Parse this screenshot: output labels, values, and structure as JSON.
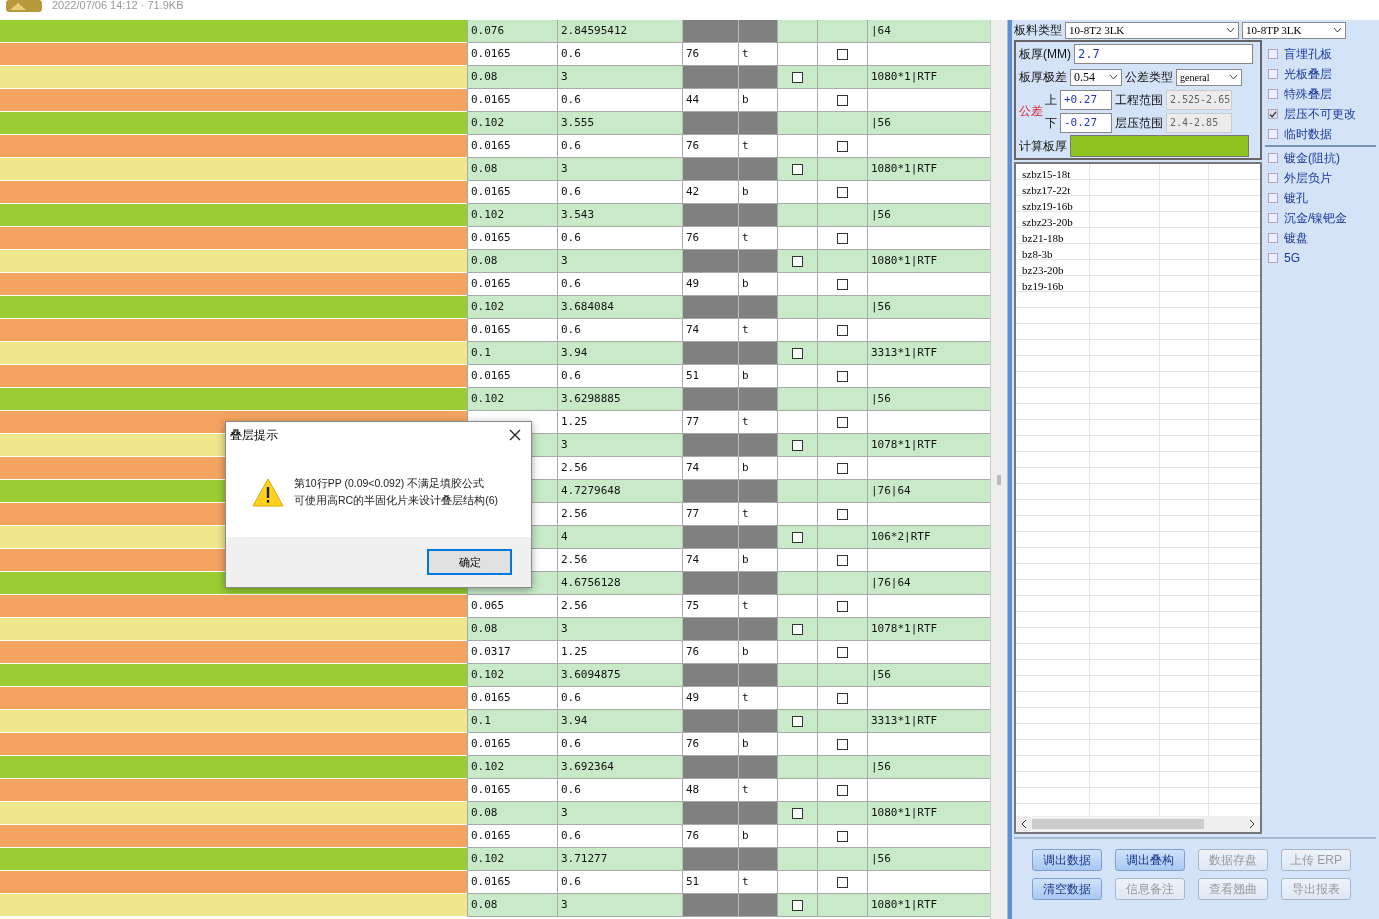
{
  "file_info": "2022/07/06 14:12 · 71.9KB",
  "rows": [
    {
      "kind": "core",
      "color": "#9acd32",
      "column_1": "0.076",
      "column_2": "2.84595412",
      "column_7": "|64"
    },
    {
      "kind": "copper",
      "color": "#f4a460",
      "column_1": "0.0165",
      "column_2": "0.6",
      "column_3": "76",
      "column_4": "t",
      "checked": false
    },
    {
      "kind": "pp",
      "color": "#f0e68c",
      "column_1": "0.08",
      "column_2": "3",
      "column_7": "1080*1|RTF",
      "checked": false
    },
    {
      "kind": "copper",
      "color": "#f4a460",
      "column_1": "0.0165",
      "column_2": "0.6",
      "column_3": "44",
      "column_4": "b",
      "checked": false
    },
    {
      "kind": "core",
      "color": "#9acd32",
      "column_1": "0.102",
      "column_2": "3.555",
      "column_7": "|56"
    },
    {
      "kind": "copper",
      "color": "#f4a460",
      "column_1": "0.0165",
      "column_2": "0.6",
      "column_3": "76",
      "column_4": "t",
      "checked": false
    },
    {
      "kind": "pp",
      "color": "#f0e68c",
      "column_1": "0.08",
      "column_2": "3",
      "column_7": "1080*1|RTF",
      "checked": false
    },
    {
      "kind": "copper",
      "color": "#f4a460",
      "column_1": "0.0165",
      "column_2": "0.6",
      "column_3": "42",
      "column_4": "b",
      "checked": false
    },
    {
      "kind": "core",
      "color": "#9acd32",
      "column_1": "0.102",
      "column_2": "3.543",
      "column_7": "|56"
    },
    {
      "kind": "copper",
      "color": "#f4a460",
      "column_1": "0.0165",
      "column_2": "0.6",
      "column_3": "76",
      "column_4": "t",
      "checked": false
    },
    {
      "kind": "pp",
      "color": "#f0e68c",
      "column_1": "0.08",
      "column_2": "3",
      "column_7": "1080*1|RTF",
      "checked": false
    },
    {
      "kind": "copper",
      "color": "#f4a460",
      "column_1": "0.0165",
      "column_2": "0.6",
      "column_3": "49",
      "column_4": "b",
      "checked": false
    },
    {
      "kind": "core",
      "color": "#9acd32",
      "column_1": "0.102",
      "column_2": "3.684084",
      "column_7": "|56"
    },
    {
      "kind": "copper",
      "color": "#f4a460",
      "column_1": "0.0165",
      "column_2": "0.6",
      "column_3": "74",
      "column_4": "t",
      "checked": false
    },
    {
      "kind": "pp",
      "color": "#f0e68c",
      "column_1": "0.1",
      "column_2": "3.94",
      "column_7": "3313*1|RTF",
      "checked": false
    },
    {
      "kind": "copper",
      "color": "#f4a460",
      "column_1": "0.0165",
      "column_2": "0.6",
      "column_3": "51",
      "column_4": "b",
      "checked": false
    },
    {
      "kind": "core",
      "color": "#9acd32",
      "column_1": "0.102",
      "column_2": "3.6298885",
      "column_7": "|56"
    },
    {
      "kind": "copper",
      "color": "#f4a460",
      "column_2": "1.25",
      "column_3": "77",
      "column_4": "t",
      "checked": false
    },
    {
      "kind": "pp",
      "color": "#f0e68c",
      "column_2": "3",
      "column_7": "1078*1|RTF",
      "checked": false
    },
    {
      "kind": "copper",
      "color": "#f4a460",
      "column_2": "2.56",
      "column_3": "74",
      "column_4": "b",
      "checked": false
    },
    {
      "kind": "core",
      "color": "#9acd32",
      "column_2": "4.7279648",
      "column_7": "|76|64"
    },
    {
      "kind": "copper",
      "color": "#f4a460",
      "column_2": "2.56",
      "column_3": "77",
      "column_4": "t",
      "checked": false
    },
    {
      "kind": "pp",
      "color": "#f0e68c",
      "column_2": "4",
      "column_7": "106*2|RTF",
      "checked": false
    },
    {
      "kind": "copper",
      "color": "#f4a460",
      "column_2": "2.56",
      "column_3": "74",
      "column_4": "b",
      "checked": false
    },
    {
      "kind": "core",
      "color": "#9acd32",
      "column_2": "4.6756128",
      "column_7": "|76|64"
    },
    {
      "kind": "copper",
      "color": "#f4a460",
      "column_1": "0.065",
      "column_2": "2.56",
      "column_3": "75",
      "column_4": "t",
      "checked": false
    },
    {
      "kind": "pp",
      "color": "#f0e68c",
      "column_1": "0.08",
      "column_2": "3",
      "column_7": "1078*1|RTF",
      "checked": false
    },
    {
      "kind": "copper",
      "color": "#f4a460",
      "column_1": "0.0317",
      "column_2": "1.25",
      "column_3": "76",
      "column_4": "b",
      "checked": false
    },
    {
      "kind": "core",
      "color": "#9acd32",
      "column_1": "0.102",
      "column_2": "3.6094875",
      "column_7": "|56"
    },
    {
      "kind": "copper",
      "color": "#f4a460",
      "column_1": "0.0165",
      "column_2": "0.6",
      "column_3": "49",
      "column_4": "t",
      "checked": false
    },
    {
      "kind": "pp",
      "color": "#f0e68c",
      "column_1": "0.1",
      "column_2": "3.94",
      "column_7": "3313*1|RTF",
      "checked": false
    },
    {
      "kind": "copper",
      "color": "#f4a460",
      "column_1": "0.0165",
      "column_2": "0.6",
      "column_3": "76",
      "column_4": "b",
      "checked": false
    },
    {
      "kind": "core",
      "color": "#9acd32",
      "column_1": "0.102",
      "column_2": "3.692364",
      "column_7": "|56"
    },
    {
      "kind": "copper",
      "color": "#f4a460",
      "column_1": "0.0165",
      "column_2": "0.6",
      "column_3": "48",
      "column_4": "t",
      "checked": false
    },
    {
      "kind": "pp",
      "color": "#f0e68c",
      "column_1": "0.08",
      "column_2": "3",
      "column_7": "1080*1|RTF",
      "checked": false
    },
    {
      "kind": "copper",
      "color": "#f4a460",
      "column_1": "0.0165",
      "column_2": "0.6",
      "column_3": "76",
      "column_4": "b",
      "checked": false
    },
    {
      "kind": "core",
      "color": "#9acd32",
      "column_1": "0.102",
      "column_2": "3.71277",
      "column_7": "|56"
    },
    {
      "kind": "copper",
      "color": "#f4a460",
      "column_1": "0.0165",
      "column_2": "0.6",
      "column_3": "51",
      "column_4": "t",
      "checked": false
    },
    {
      "kind": "pp",
      "color": "#f0e68c",
      "column_1": "0.08",
      "column_2": "3",
      "column_7": "1080*1|RTF",
      "checked": false
    }
  ],
  "material": {
    "label": "板料类型",
    "select_1": "10-8T2 3LK",
    "select_2": "10-8TP 3LK"
  },
  "thickness": {
    "label": "板厚(MM)",
    "value": "2.7"
  },
  "range": {
    "label": "板厚极差",
    "value": "0.54"
  },
  "tolerance_type": {
    "label": "公差类型",
    "value": "general"
  },
  "tolerance": {
    "label": "公差",
    "upper_label": "上",
    "upper": "+0.27",
    "lower_label": "下",
    "lower": "-0.27"
  },
  "engineering_range": {
    "label": "工程范围",
    "value": "2.525-2.65"
  },
  "press_range": {
    "label": "层压范围",
    "value": "2.4-2.85"
  },
  "calculated": {
    "label": "计算板厚"
  },
  "list_items": [
    "szbz15-18t",
    "szbz17-22t",
    "szbz19-16b",
    "szbz23-20b",
    "bz21-18b",
    "bz8-3b",
    "bz23-20b",
    "bz19-16b"
  ],
  "option_groups": [
    {
      "items": [
        {
          "label": "盲埋孔板",
          "checked": false
        },
        {
          "label": "光板叠层",
          "checked": false
        },
        {
          "label": "特殊叠层",
          "checked": false
        },
        {
          "label": "层压不可更改",
          "checked": true
        },
        {
          "label": "临时数据",
          "checked": false
        }
      ]
    },
    {
      "items": [
        {
          "label": "镀金(阻抗)",
          "checked": false
        },
        {
          "label": "外层负片",
          "checked": false
        },
        {
          "label": "镀孔",
          "checked": false
        },
        {
          "label": "沉金/镍钯金",
          "checked": false
        },
        {
          "label": "镀盘",
          "checked": false
        },
        {
          "label": "5G",
          "checked": false
        }
      ]
    }
  ],
  "buttons": [
    {
      "label": "调出数据",
      "disabled": false
    },
    {
      "label": "调出叠构",
      "disabled": false
    },
    {
      "label": "数据存盘",
      "disabled": true
    },
    {
      "label": "上传 ERP",
      "disabled": true
    },
    {
      "label": "清空数据",
      "disabled": false
    },
    {
      "label": "信息备注",
      "disabled": true
    },
    {
      "label": "查看翘曲",
      "disabled": true
    },
    {
      "label": "导出报表",
      "disabled": true
    }
  ],
  "dialog": {
    "title": "叠层提示",
    "message_lines": [
      "第10行PP (0.09<0.092) 不满足填胶公式",
      "可使用高RC的半固化片来设计叠层结构(6)"
    ],
    "button": "确定"
  }
}
